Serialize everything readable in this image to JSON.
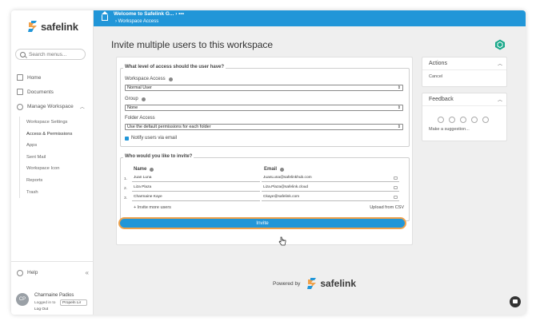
{
  "brand": {
    "name": "safelink",
    "accent": "#2196d8",
    "highlight": "#f0a14a"
  },
  "sidebar": {
    "search_placeholder": "Search menus...",
    "items": [
      {
        "label": "Home",
        "icon": "home-icon"
      },
      {
        "label": "Documents",
        "icon": "documents-icon"
      },
      {
        "label": "Manage Workspace",
        "icon": "gear-icon"
      }
    ],
    "sub_items": [
      "Workspace Settings",
      "Access & Permissions",
      "Apps",
      "Sent Mail",
      "Workspace Icon",
      "Reports",
      "Trash"
    ],
    "help_label": "Help",
    "collapse_glyph": "«",
    "user": {
      "initials": "CP",
      "name": "Charmaine Padios",
      "logged_in_label": "Logged in to",
      "org_selected": "Propeln Lir",
      "logout_label": "Log Out"
    }
  },
  "topbar": {
    "breadcrumb_primary": "Welcome to Safelink G...",
    "breadcrumb_more": "›  •••",
    "breadcrumb_secondary": "Workspace Access"
  },
  "main": {
    "title": "Invite multiple users to this workspace",
    "access_section": {
      "legend": "What level of access should the user have?",
      "workspace_access_label": "Workspace Access",
      "workspace_access_value": "Normal User",
      "group_label": "Group",
      "group_value": "None",
      "folder_access_label": "Folder Access",
      "folder_access_value": "Use the default permissions for each folder",
      "notify_label": "Notify users via email",
      "notify_checked": true
    },
    "invite_section": {
      "legend": "Who would you like to invite?",
      "name_header": "Name",
      "email_header": "Email",
      "rows": [
        {
          "num": "1.",
          "name": "Juan Luna",
          "email": "JuanLuna@safelinkhub.com"
        },
        {
          "num": "2.",
          "name": "Liza Plaza",
          "email": "Liza.Plaza@safelink.cloud"
        },
        {
          "num": "3.",
          "name": "Charmaine Kaye",
          "email": "Ckaye@safelink.com"
        }
      ],
      "invite_more": "+ Invite more users",
      "upload_csv": "Upload from CSV"
    },
    "invite_button": "Invite"
  },
  "actions_panel": {
    "title": "Actions",
    "cancel_label": "Cancel"
  },
  "feedback_panel": {
    "title": "Feedback",
    "suggestion_label": "Make a suggestion..."
  },
  "footer": {
    "powered_by": "Powered by",
    "brand": "safelink"
  }
}
